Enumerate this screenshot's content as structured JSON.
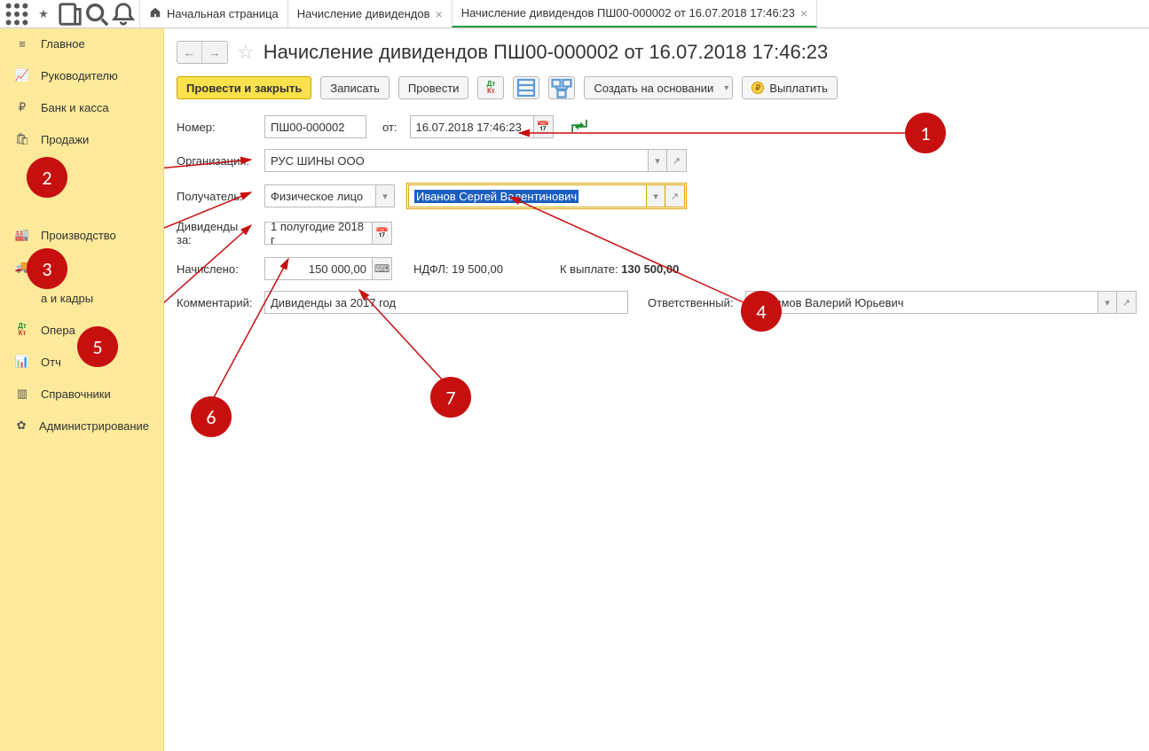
{
  "tabs": {
    "t0": "Начальная страница",
    "t1": "Начисление дивидендов",
    "t2": "Начисление дивидендов ПШ00-000002 от 16.07.2018 17:46:23"
  },
  "sidebar": {
    "glavnoe": "Главное",
    "rukovod": "Руководителю",
    "bank": "Банк и касса",
    "prodazhi": "Продажи",
    "proizvod": "Производство",
    "kadry": "а и кадры",
    "oper": "Опера",
    "otch": "Отч",
    "sprav": "Справочники",
    "admin": "Администрирование"
  },
  "page": {
    "title": "Начисление дивидендов ПШ00-000002 от 16.07.2018 17:46:23"
  },
  "toolbar": {
    "provesti_zakryt": "Провести и закрыть",
    "zapisat": "Записать",
    "provesti": "Провести",
    "sozdat": "Создать на основании",
    "vyplatit": "Выплатить"
  },
  "labels": {
    "nomer": "Номер:",
    "ot": "от:",
    "org": "Организация:",
    "poluchatel": "Получатель:",
    "dividendy_za": "Дивиденды за:",
    "nachisleno": "Начислено:",
    "ndfl": "НДФЛ:",
    "k_vyplate": "К выплате:",
    "kommentariy": "Комментарий:",
    "otvetstv": "Ответственный:"
  },
  "values": {
    "nomer": "ПШ00-000002",
    "date": "16.07.2018 17:46:23",
    "org": "РУС ШИНЫ ООО",
    "recipient_type": "Физическое лицо",
    "recipient": "Иванов Сергей Валентинович",
    "period": "1 полугодие 2018 г",
    "nachisleno": "150 000,00",
    "ndfl": "19 500,00",
    "k_vyplate": "130 500,00",
    "kommentariy": "Дивиденды за 2017 год",
    "otvetstv": "Любимов Валерий Юрьевич"
  },
  "callouts": {
    "c1": "1",
    "c2": "2",
    "c3": "3",
    "c4": "4",
    "c5": "5",
    "c6": "6",
    "c7": "7"
  }
}
